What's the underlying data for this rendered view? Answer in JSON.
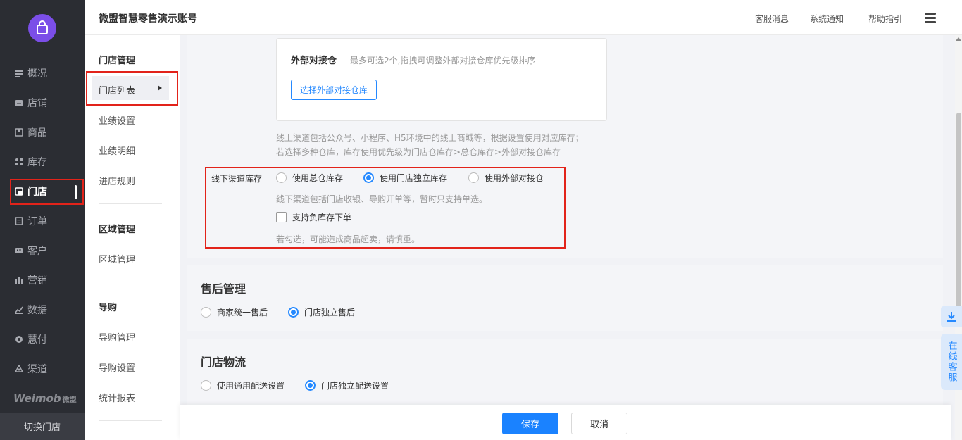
{
  "sidebar": {
    "items": [
      {
        "label": "概况",
        "icon": "overview-icon"
      },
      {
        "label": "店铺",
        "icon": "shop-icon"
      },
      {
        "label": "商品",
        "icon": "goods-icon"
      },
      {
        "label": "库存",
        "icon": "inventory-icon"
      },
      {
        "label": "门店",
        "icon": "store-icon"
      },
      {
        "label": "订单",
        "icon": "order-icon"
      },
      {
        "label": "客户",
        "icon": "customer-icon"
      },
      {
        "label": "营销",
        "icon": "marketing-icon"
      },
      {
        "label": "数据",
        "icon": "data-icon"
      },
      {
        "label": "慧付",
        "icon": "pay-icon"
      },
      {
        "label": "渠道",
        "icon": "channel-icon"
      }
    ],
    "active": "门店",
    "brand": "Weimob",
    "brand_cn": "微盟",
    "switch_store": "切换门店"
  },
  "submenu": {
    "groups": [
      {
        "title": "门店管理",
        "items": [
          "门店列表",
          "业绩设置",
          "业绩明细",
          "进店规则"
        ]
      },
      {
        "title": "区域管理",
        "items": [
          "区域管理"
        ]
      },
      {
        "title": "导购",
        "items": [
          "导购管理",
          "导购设置",
          "统计报表"
        ]
      }
    ],
    "active": "门店列表"
  },
  "header": {
    "account": "微盟智慧零售演示账号",
    "links": [
      "客服消息",
      "系统通知",
      "帮助指引"
    ]
  },
  "external_warehouse": {
    "title": "外部对接仓",
    "hint": "最多可选2个,拖拽可调整外部对接仓库优先级排序",
    "button": "选择外部对接仓库"
  },
  "online_note": [
    "线上渠道包括公众号、小程序、H5环境中的线上商城等，根据设置使用对应库存；",
    "若选择多种仓库，库存使用优先级为门店仓库存>总仓库存>外部对接仓库存"
  ],
  "offline": {
    "label": "线下渠道库存",
    "options": [
      "使用总仓库存",
      "使用门店独立库存",
      "使用外部对接仓"
    ],
    "selected": "使用门店独立库存",
    "note": "线下渠道包括门店收银、导购开单等，暂时只支持单选。",
    "checkbox": "支持负库存下单",
    "checkbox_checked": false,
    "checkbox_note": "若勾选，可能造成商品超卖，请慎重。"
  },
  "aftersale": {
    "title": "售后管理",
    "options": [
      "商家统一售后",
      "门店独立售后"
    ],
    "selected": "门店独立售后"
  },
  "logistics": {
    "title": "门店物流",
    "options": [
      "使用通用配送设置",
      "门店独立配送设置"
    ],
    "selected": "门店独立配送设置"
  },
  "actions": {
    "save": "保存",
    "cancel": "取消"
  },
  "floating": {
    "customer_service": "在线客服"
  },
  "colors": {
    "accent": "#2589ff",
    "highlight": "#e2231a",
    "sidebar": "#2b2d33",
    "logo": "#7b4ee8"
  }
}
